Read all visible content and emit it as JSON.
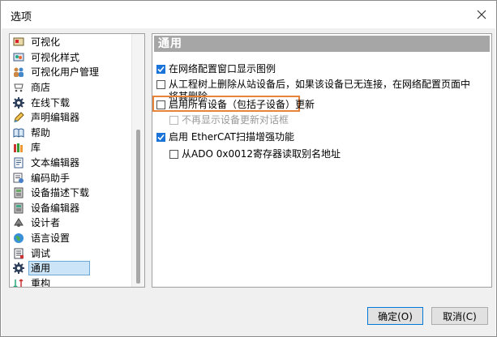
{
  "window": {
    "title": "选项"
  },
  "sidebar": {
    "items": [
      {
        "label": "可视化",
        "icon": "visualization-icon",
        "selected": false
      },
      {
        "label": "可视化样式",
        "icon": "visualization-style-icon",
        "selected": false
      },
      {
        "label": "可视化用户管理",
        "icon": "users-icon",
        "selected": false
      },
      {
        "label": "商店",
        "icon": "store-icon",
        "selected": false
      },
      {
        "label": "在线下载",
        "icon": "gear-icon",
        "selected": false
      },
      {
        "label": "声明编辑器",
        "icon": "declaration-editor-icon",
        "selected": false
      },
      {
        "label": "帮助",
        "icon": "help-book-icon",
        "selected": false
      },
      {
        "label": "库",
        "icon": "library-icon",
        "selected": false
      },
      {
        "label": "文本编辑器",
        "icon": "text-editor-icon",
        "selected": false
      },
      {
        "label": "编码助手",
        "icon": "coding-assistant-icon",
        "selected": false
      },
      {
        "label": "设备描述下载",
        "icon": "device-description-icon",
        "selected": false
      },
      {
        "label": "设备编辑器",
        "icon": "device-editor-icon",
        "selected": false
      },
      {
        "label": "设计者",
        "icon": "designer-icon",
        "selected": false
      },
      {
        "label": "语言设置",
        "icon": "globe-icon",
        "selected": false
      },
      {
        "label": "调试",
        "icon": "debug-icon",
        "selected": false
      },
      {
        "label": "通用",
        "icon": "gear-icon",
        "selected": true
      },
      {
        "label": "重构",
        "icon": "refactor-icon",
        "selected": false
      }
    ]
  },
  "content": {
    "header": "通用",
    "options": [
      {
        "label": "在网络配置窗口显示图例",
        "checked": true,
        "disabled": false
      },
      {
        "label": "从工程树上删除从站设备后，如果该设备已无连接，在网络配置页面中将其删除",
        "checked": false,
        "disabled": false
      },
      {
        "label": "启用所有设备（包括子设备）更新",
        "checked": false,
        "disabled": false
      },
      {
        "label": "不再显示设备更新对话框",
        "checked": false,
        "disabled": true
      },
      {
        "label": "启用 EtherCAT扫描增强功能",
        "checked": true,
        "disabled": false
      },
      {
        "label": "从ADO 0x0012寄存器读取别名地址",
        "checked": false,
        "disabled": false
      }
    ]
  },
  "buttons": {
    "ok": "确定(O)",
    "cancel": "取消(C)"
  },
  "colors": {
    "accent": "#1a73d9",
    "highlight": "#e8833a",
    "header_bg": "#a6a6a6",
    "selection": "#cce4f7"
  }
}
